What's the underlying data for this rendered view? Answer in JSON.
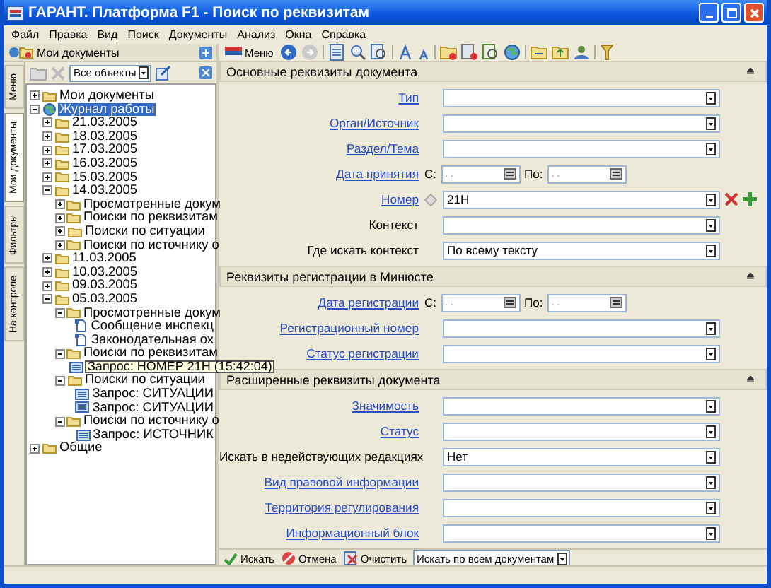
{
  "window": {
    "title": "ГАРАНТ. Платформа F1 - Поиск по реквизитам"
  },
  "menu": [
    "Файл",
    "Правка",
    "Вид",
    "Поиск",
    "Документы",
    "Анализ",
    "Окна",
    "Справка"
  ],
  "left_panel": {
    "title": "Мои документы",
    "filter": "Все объекты",
    "tabs": [
      {
        "label": "Меню",
        "selected": false
      },
      {
        "label": "Мои документы",
        "selected": true
      },
      {
        "label": "Фильтры",
        "selected": false
      },
      {
        "label": "На контроле",
        "selected": false
      }
    ],
    "tree": [
      {
        "label": "Мои документы",
        "kind": "folder",
        "expanded": false,
        "selected": false
      },
      {
        "label": "Журнал работы",
        "kind": "journal",
        "expanded": true,
        "selected": true,
        "children": [
          {
            "label": "21.03.2005",
            "kind": "folder",
            "expanded": false,
            "selected": false
          },
          {
            "label": "18.03.2005",
            "kind": "folder",
            "expanded": false,
            "selected": false
          },
          {
            "label": "17.03.2005",
            "kind": "folder",
            "expanded": false,
            "selected": false
          },
          {
            "label": "16.03.2005",
            "kind": "folder",
            "expanded": false,
            "selected": false
          },
          {
            "label": "15.03.2005",
            "kind": "folder",
            "expanded": false,
            "selected": false
          },
          {
            "label": "14.03.2005",
            "kind": "folder",
            "expanded": true,
            "selected": false,
            "children": [
              {
                "label": "Просмотренные докум",
                "kind": "folder",
                "expanded": false,
                "selected": false
              },
              {
                "label": "Поиски по реквизитам",
                "kind": "folder",
                "expanded": false,
                "selected": false
              },
              {
                "label": "Поиски по ситуации",
                "kind": "folder",
                "expanded": false,
                "selected": false
              },
              {
                "label": "Поиски по источнику о",
                "kind": "folder",
                "expanded": false,
                "selected": false
              }
            ]
          },
          {
            "label": "11.03.2005",
            "kind": "folder",
            "expanded": false,
            "selected": false
          },
          {
            "label": "10.03.2005",
            "kind": "folder",
            "expanded": false,
            "selected": false
          },
          {
            "label": "09.03.2005",
            "kind": "folder",
            "expanded": false,
            "selected": false
          },
          {
            "label": "05.03.2005",
            "kind": "folder",
            "expanded": true,
            "selected": false,
            "children": [
              {
                "label": "Просмотренные докум",
                "kind": "folder",
                "expanded": true,
                "selected": false,
                "children": [
                  {
                    "label": "Сообщение инспекц",
                    "kind": "document",
                    "selected": false
                  },
                  {
                    "label": "Законодательная ох",
                    "kind": "document",
                    "selected": false
                  }
                ]
              },
              {
                "label": "Поиски по реквизитам",
                "kind": "folder",
                "expanded": true,
                "selected": false,
                "children": [
                  {
                    "label": "Запрос: НОМЕР 21Н (15:42:04)",
                    "kind": "query",
                    "selected": false,
                    "tooltip": true
                  }
                ]
              },
              {
                "label": "Поиски по ситуации",
                "kind": "folder",
                "expanded": true,
                "selected": false,
                "children": [
                  {
                    "label": "Запрос: СИТУАЦИИ",
                    "kind": "query",
                    "selected": false,
                    "tooltip": false
                  },
                  {
                    "label": "Запрос: СИТУАЦИИ",
                    "kind": "query",
                    "selected": false,
                    "tooltip": false
                  }
                ]
              },
              {
                "label": "Поиски по источнику о",
                "kind": "folder",
                "expanded": true,
                "selected": false,
                "children": [
                  {
                    "label": "Запрос: ИСТОЧНИК",
                    "kind": "query",
                    "selected": false,
                    "tooltip": false
                  }
                ]
              }
            ]
          }
        ]
      },
      {
        "label": "Общие",
        "kind": "folder",
        "expanded": false,
        "selected": false
      }
    ]
  },
  "toolbar": {
    "menu_button": "Меню"
  },
  "sections": [
    {
      "title": "Основные реквизиты документа",
      "rows": [
        {
          "kind": "combo",
          "label": "Тип",
          "link": true
        },
        {
          "kind": "combo",
          "label": "Орган/Источник",
          "link": true
        },
        {
          "kind": "combo",
          "label": "Раздел/Тема",
          "link": true
        },
        {
          "kind": "date_range",
          "label": "Дата принятия",
          "link": true,
          "from_label": "С:",
          "from": ". .",
          "to_label": "По:",
          "to": ". ."
        },
        {
          "kind": "combo",
          "label": "Номер",
          "link": true,
          "value": "21Н",
          "actions": true
        },
        {
          "kind": "combo",
          "label": "Контекст",
          "link": false
        },
        {
          "kind": "combo",
          "label": "Где искать контекст",
          "link": false,
          "value": "По всему тексту"
        }
      ]
    },
    {
      "title": "Реквизиты регистрации в Минюсте",
      "rows": [
        {
          "kind": "date_range",
          "label": "Дата регистрации",
          "link": true,
          "from_label": "С:",
          "from": ". .",
          "to_label": "По:",
          "to": ". ."
        },
        {
          "kind": "combo",
          "label": "Регистрационный номер",
          "link": true
        },
        {
          "kind": "combo",
          "label": "Статус регистрации",
          "link": true
        }
      ]
    },
    {
      "title": "Расширенные реквизиты документа",
      "rows": [
        {
          "kind": "combo",
          "label": "Значимость",
          "link": true
        },
        {
          "kind": "combo",
          "label": "Статус",
          "link": true
        },
        {
          "kind": "combo",
          "label": "Искать в недействующих редакциях",
          "link": false,
          "value": "Нет"
        },
        {
          "kind": "combo",
          "label": "Вид правовой информации",
          "link": true
        },
        {
          "kind": "combo",
          "label": "Территория регулирования",
          "link": true
        },
        {
          "kind": "combo",
          "label": "Информационный блок",
          "link": true
        }
      ]
    }
  ],
  "bottom_bar": {
    "buttons": [
      {
        "label": "Искать",
        "kind": "search"
      },
      {
        "label": "Отмена",
        "kind": "cancel"
      },
      {
        "label": "Очистить",
        "kind": "clear"
      }
    ],
    "scope": "Искать по всем документам"
  }
}
